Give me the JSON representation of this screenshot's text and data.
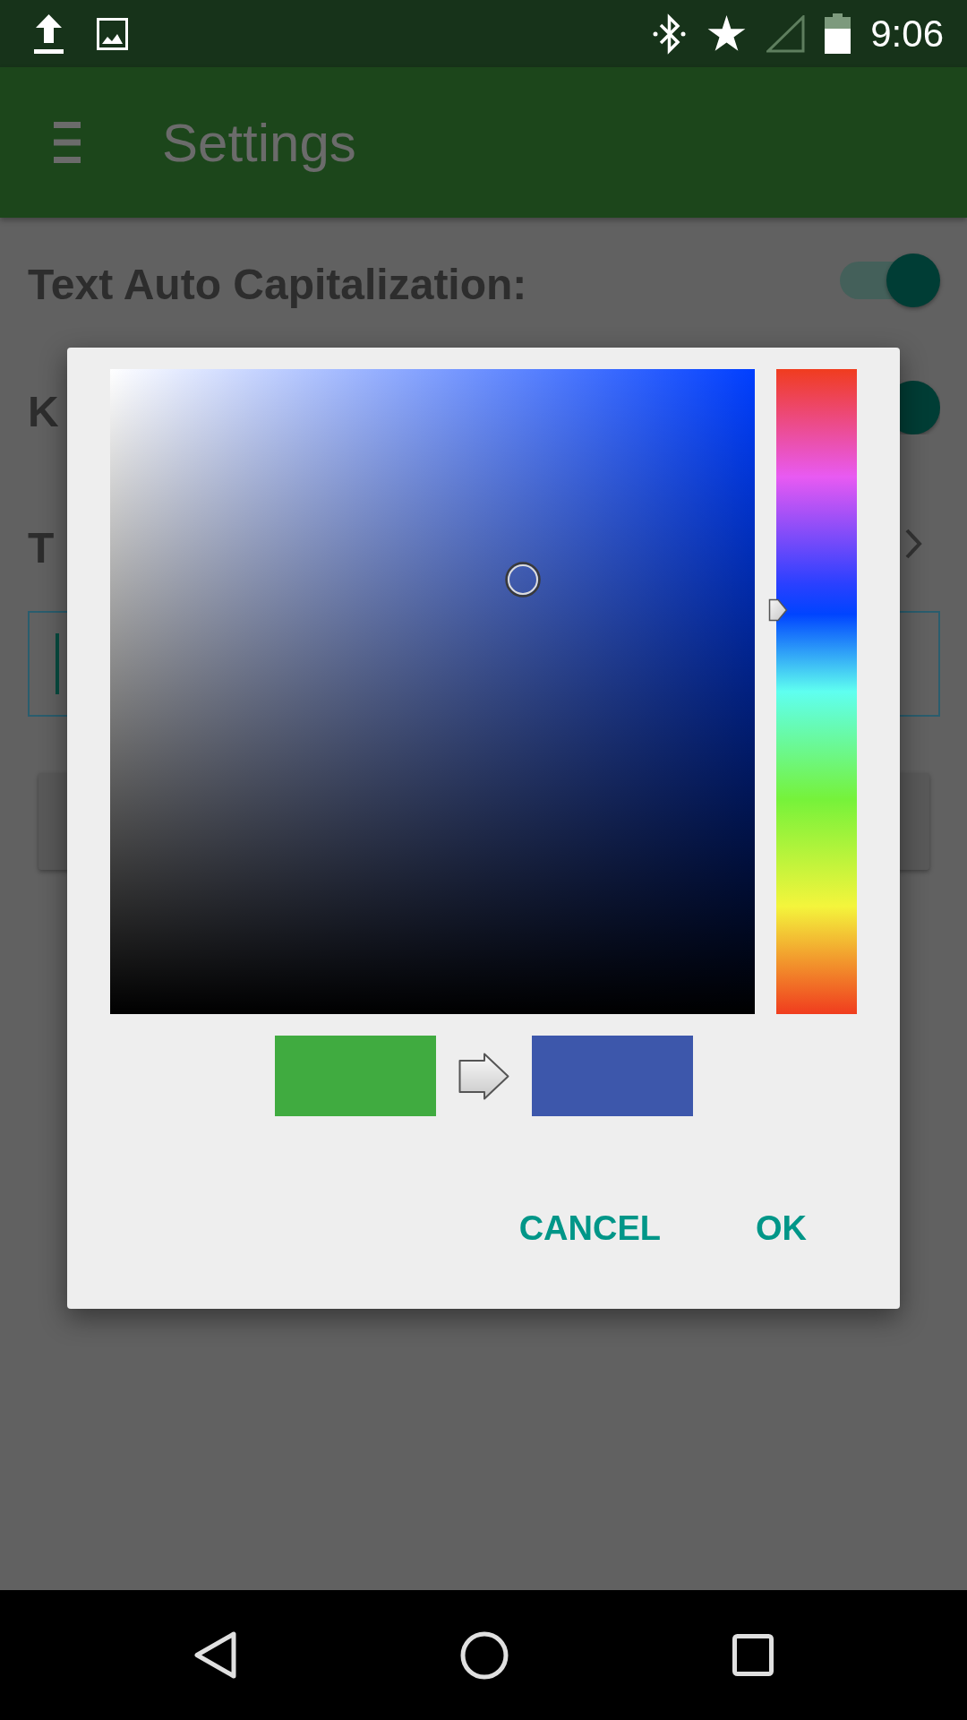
{
  "status_bar": {
    "time": "9:06"
  },
  "app_bar": {
    "title": "Settings"
  },
  "settings": [
    {
      "kind": "switch",
      "label": "Text Auto Capitalization:",
      "on": true
    },
    {
      "kind": "switch",
      "label": "K",
      "on": true
    },
    {
      "kind": "link",
      "label": "T"
    },
    {
      "kind": "input",
      "focused": true
    },
    {
      "kind": "button"
    }
  ],
  "color_picker": {
    "color_field": {
      "horizontal": {
        "level": 0.64
      },
      "vertical": {
        "level": 0.674
      }
    },
    "hue_bar": {
      "level": 0.626
    },
    "swatches": [
      {
        "color": "#40ab40"
      },
      {
        "color": "#3d57ab"
      }
    ],
    "buttons": [
      "CANCEL",
      "OK"
    ]
  }
}
